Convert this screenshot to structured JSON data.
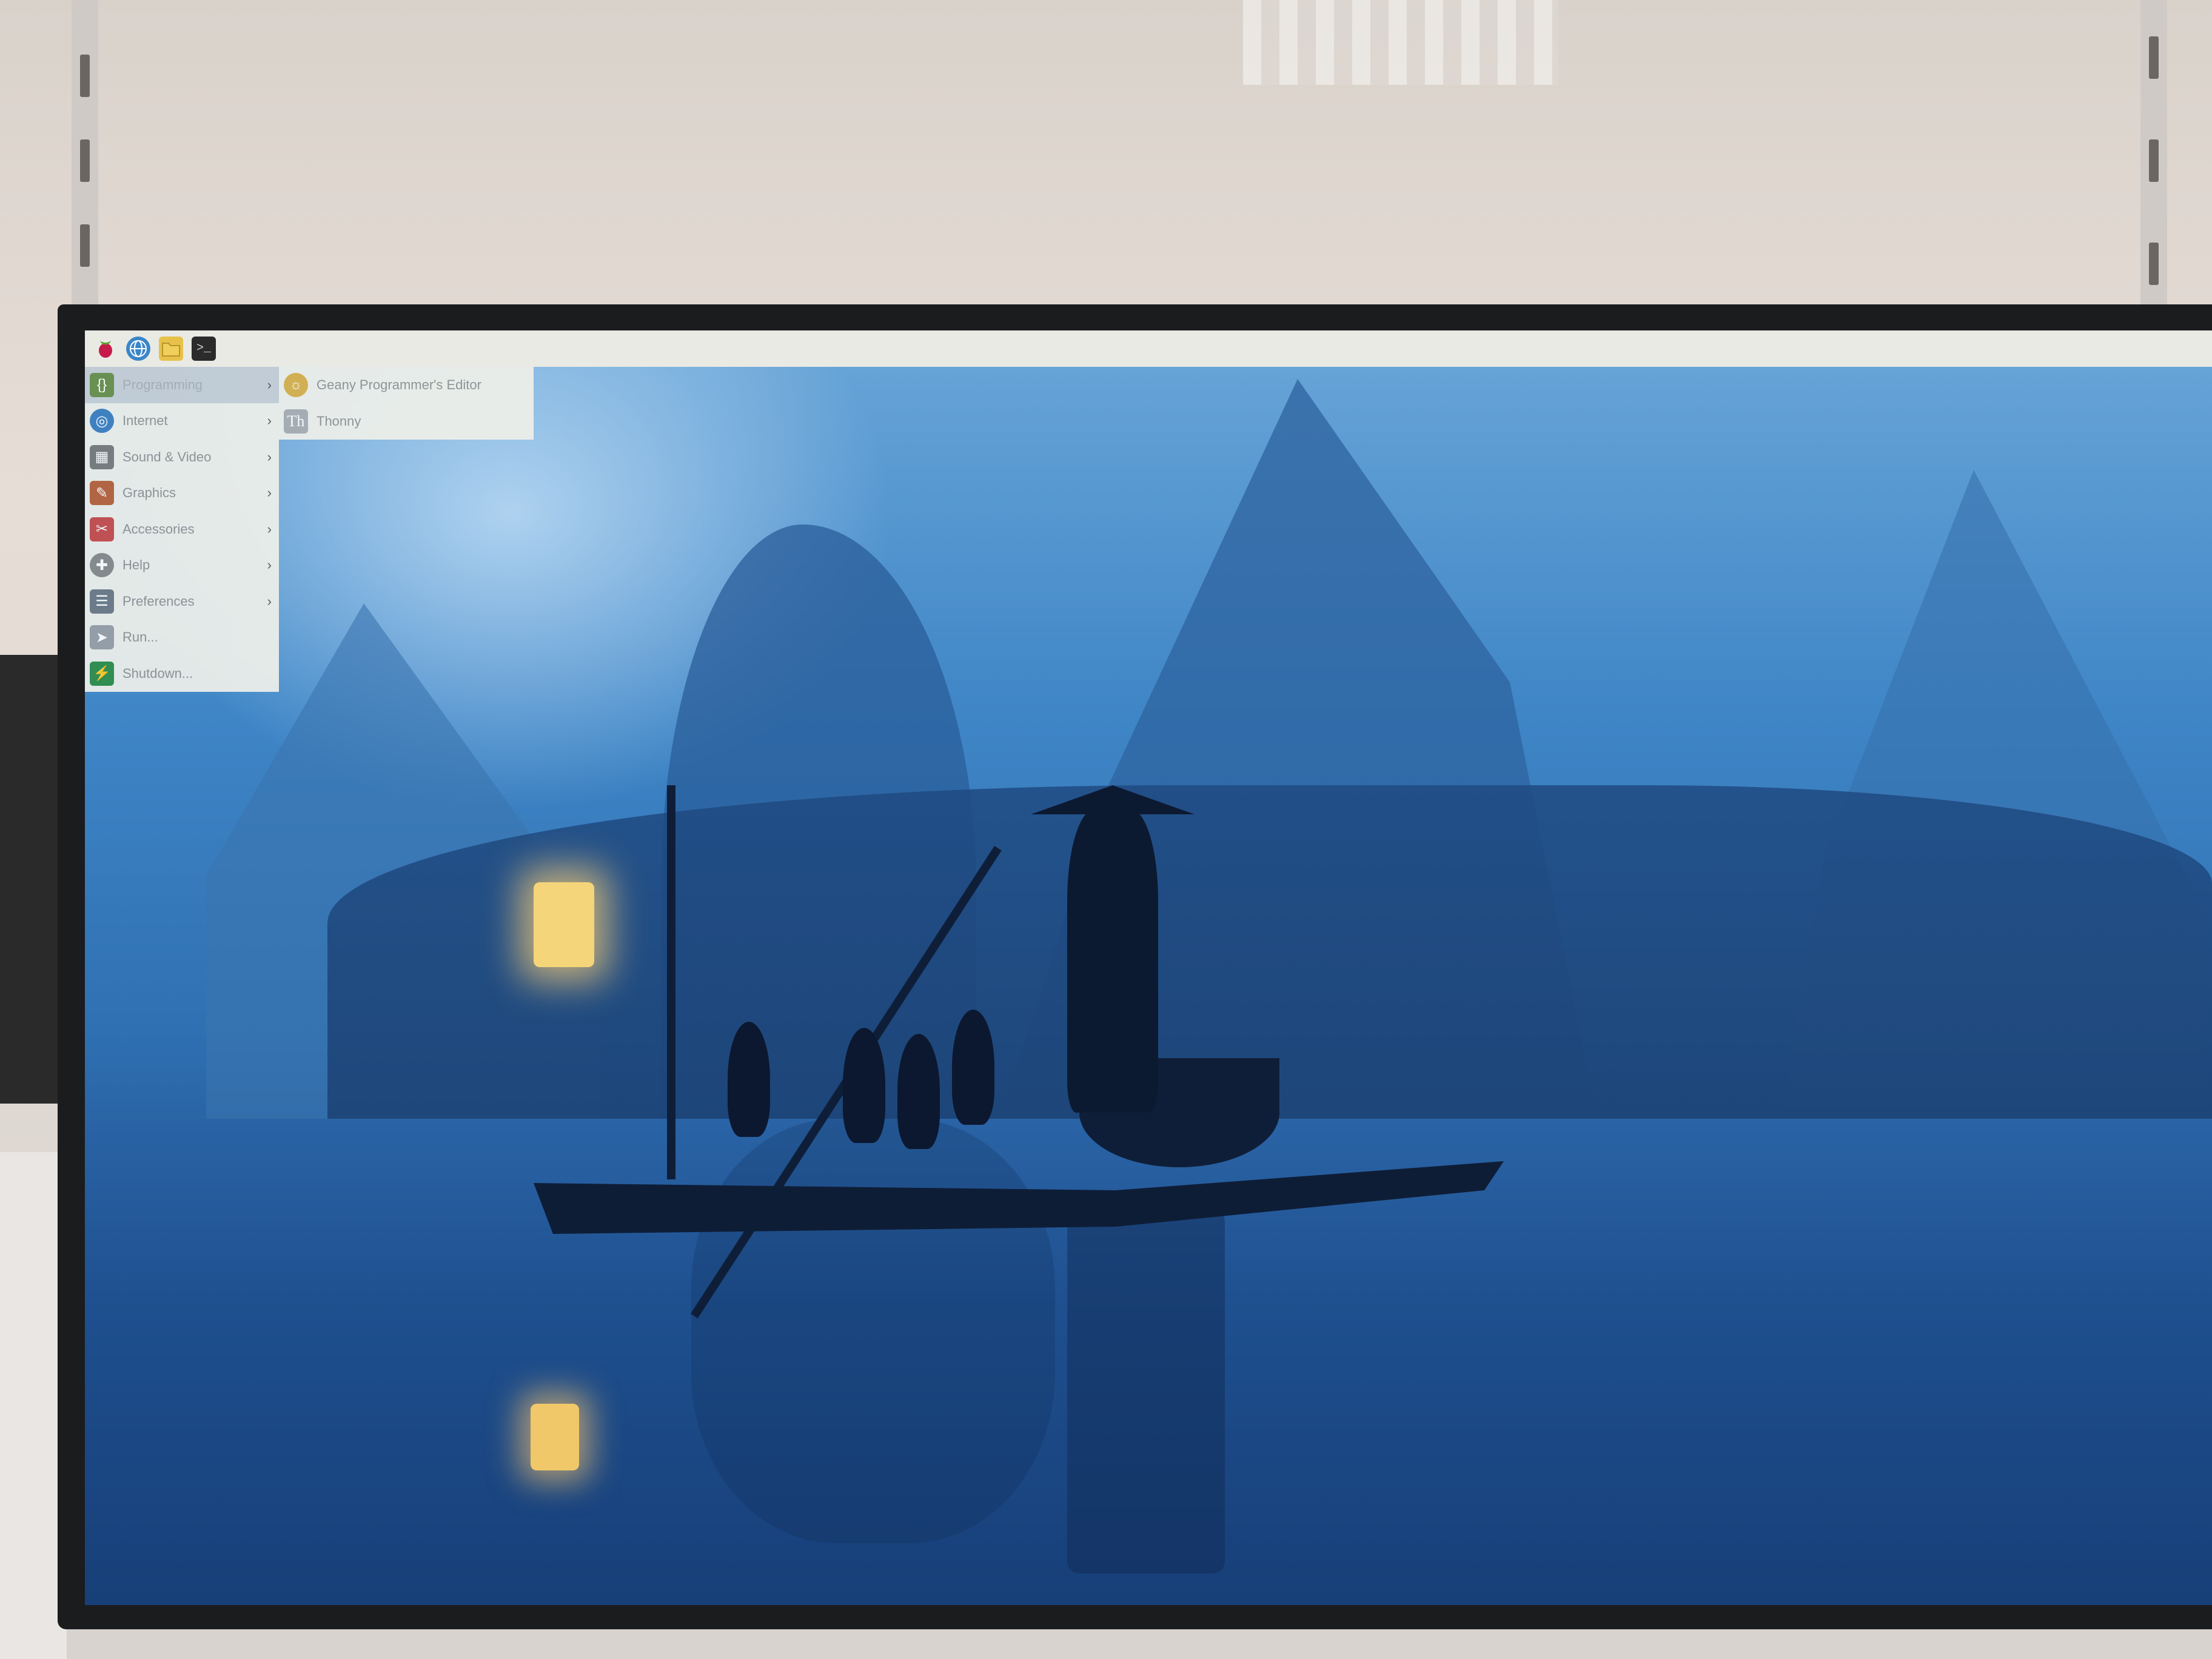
{
  "panel": {
    "icons": [
      "raspberry-icon",
      "web-browser-icon",
      "file-manager-icon",
      "terminal-icon"
    ],
    "terminal_glyph": ">_"
  },
  "menu": {
    "items": [
      {
        "label": "Programming",
        "icon": "programming-icon",
        "has_submenu": true
      },
      {
        "label": "Internet",
        "icon": "internet-icon",
        "has_submenu": true
      },
      {
        "label": "Sound & Video",
        "icon": "sound-video-icon",
        "has_submenu": true
      },
      {
        "label": "Graphics",
        "icon": "graphics-icon",
        "has_submenu": true
      },
      {
        "label": "Accessories",
        "icon": "accessories-icon",
        "has_submenu": true
      },
      {
        "label": "Help",
        "icon": "help-icon",
        "has_submenu": true
      },
      {
        "label": "Preferences",
        "icon": "preferences-icon",
        "has_submenu": true
      },
      {
        "label": "Run...",
        "icon": "run-icon",
        "has_submenu": false
      },
      {
        "label": "Shutdown...",
        "icon": "shutdown-icon",
        "has_submenu": false
      }
    ],
    "submenu": [
      {
        "label": "Geany Programmer's Editor",
        "icon": "geany-icon"
      },
      {
        "label": "Thonny",
        "icon": "thonny-icon"
      }
    ],
    "arrow": "›"
  },
  "colors": {
    "panel": "#e9eae4",
    "menu_bg": "#eef0ea",
    "menu_active": "#c7cfd6",
    "menu_text": "#8f9393"
  }
}
